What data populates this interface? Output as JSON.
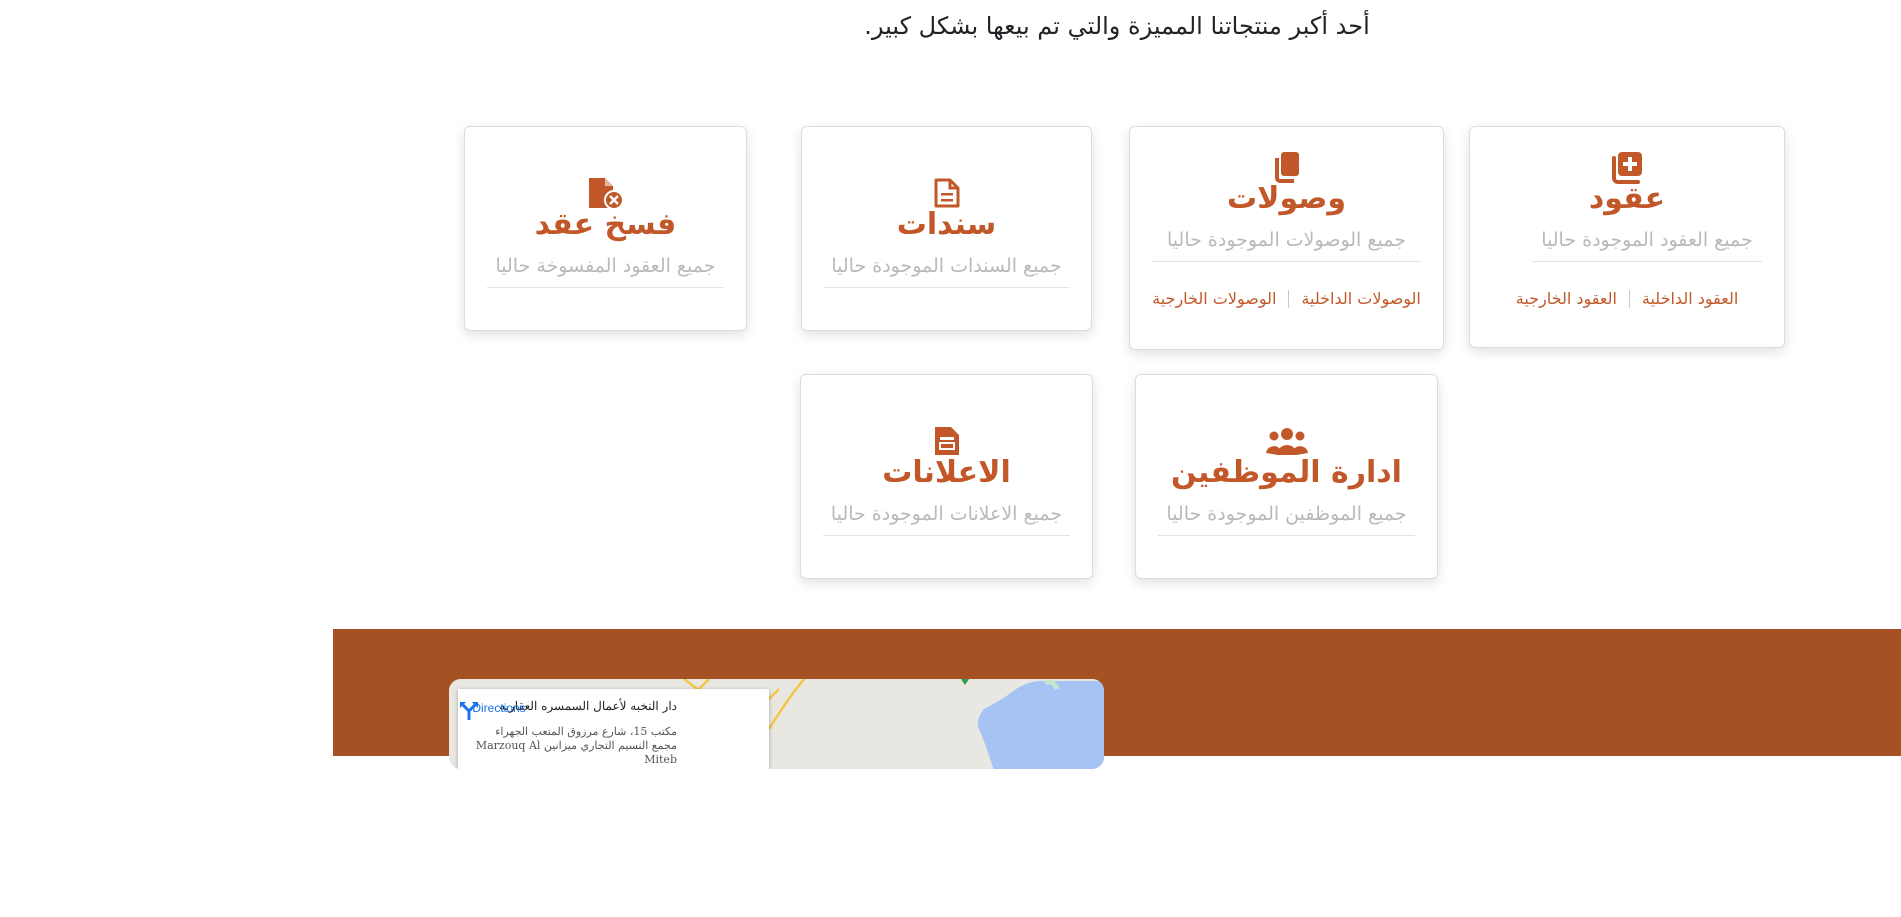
{
  "section": {
    "heading": "أحد أكبر منتجاتنا المميزة والتي تم بيعها بشكل كبير."
  },
  "colors": {
    "accent": "#c2582a",
    "band": "#a55123",
    "muted_text": "#b9b9b9"
  },
  "cards": {
    "contracts": {
      "icon": "contract-add-icon",
      "title": "عقود",
      "subtitle": "جميع العقود الموجودة حاليا",
      "link_internal": "العقود الداخلية",
      "link_external": "العقود الخارجية"
    },
    "receipts": {
      "icon": "copy-documents-icon",
      "title": "وصولات",
      "subtitle": "جميع الوصولات الموجودة حاليا",
      "link_internal": "الوصولات الداخلية",
      "link_external": "الوصولات الخارجية"
    },
    "bonds": {
      "icon": "document-icon",
      "title": "سندات",
      "subtitle": "جميع السندات الموجودة حاليا"
    },
    "termination": {
      "icon": "document-cancel-icon",
      "title": "فسخ عقد",
      "subtitle": "جميع العقود المفسوخة حاليا"
    },
    "employees": {
      "icon": "users-group-icon",
      "title": "ادارة الموظفين",
      "subtitle": "جميع الموظفين الموجودة حاليا"
    },
    "ads": {
      "icon": "announcement-document-icon",
      "title": "الاعلانات",
      "subtitle": "جميع الاعلانات الموجودة حاليا"
    }
  },
  "map": {
    "place_name": "دار النخبه لأعمال السمسره العقاريه",
    "address": "مكتب 15، شارع مرزوق المتعب الجهراء مجمع النسيم التجاري ميزانين Marzouq Al Miteb",
    "directions_label": "Directions"
  }
}
